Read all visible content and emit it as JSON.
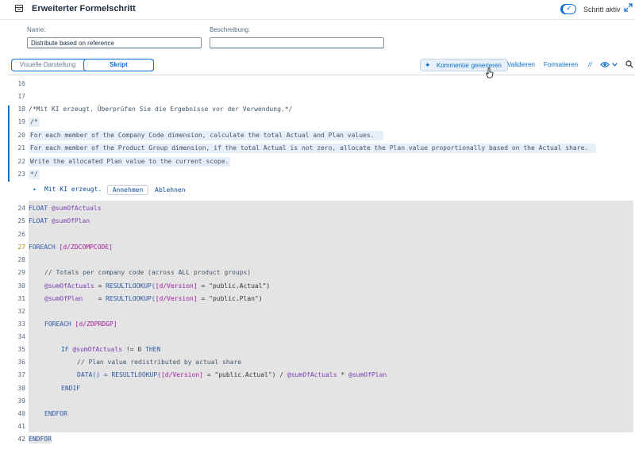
{
  "header": {
    "title": "Erweiterter Formelschritt",
    "step_active_label": "Schritt aktiv"
  },
  "form": {
    "name_label": "Name:",
    "name_value": "Distribute based on reference",
    "description_label": "Beschreibung:",
    "description_value": ""
  },
  "toolbar": {
    "tab_visual": "Visuelle Darstellung",
    "tab_script": "Skript",
    "generate_comment": "Kommentar generieren",
    "validate": "Validieren",
    "format": "Formatieren",
    "comment_toggle": "//"
  },
  "editor": {
    "line_numbers": [
      "16",
      "17",
      "18",
      "19",
      "20",
      "21",
      "22",
      "23",
      "24",
      "25",
      "26",
      "27",
      "28",
      "29",
      "30",
      "31",
      "32",
      "33",
      "34",
      "35",
      "36",
      "37",
      "38",
      "39",
      "40",
      "41",
      "42"
    ],
    "ai_comment_header": "/*Mit KI erzeugt. Überprüfen Sie die Ergebnisse vor der Verwendung.*/",
    "ai_comment_open": "/*",
    "ai_line_1": "For each member of the Company Code dimension, calculate the total Actual and Plan values.",
    "ai_line_2": "For each member of the Product Group dimension, if the total Actual is not zero, allocate the Plan value proportionally based on the Actual share.",
    "ai_line_3": "Write the allocated Plan value to the current scope.",
    "ai_comment_close": "*/",
    "ai_generated_label": "Mit KI erzeugt.",
    "accept_label": "Annehmen",
    "reject_label": "Ablehnen",
    "code": {
      "l24_kw": "FLOAT",
      "l24_var": "@sumOfActuals",
      "l25_kw": "FLOAT",
      "l25_var": "@sumOfPlan",
      "l27_kw": "FOREACH",
      "l27_dim": "[d/ZDCOMPCODE]",
      "l29_comment": "// Totals per company code (across ALL product groups)",
      "l30_var": "@sumOfActuals",
      "l30_eq": " = ",
      "l30_fn": "RESULTLOOKUP(",
      "l30_dim": "[d/Version]",
      "l30_rest": " = \"public.Actual\")",
      "l31_var": "@sumOfPlan",
      "l31_eq": "    = ",
      "l31_fn": "RESULTLOOKUP(",
      "l31_dim": "[d/Version]",
      "l31_rest": " = \"public.Plan\")",
      "l33_kw": "FOREACH",
      "l33_dim": "[d/ZDPRDGP]",
      "l35_kw": "IF",
      "l35_var": "@sumOfActuals",
      "l35_op": " != 0 ",
      "l35_kw2": "THEN",
      "l36_comment": "// Plan value redistributed by actual share",
      "l37_fn": "DATA() = RESULTLOOKUP(",
      "l37_dim": "[d/Version]",
      "l37_mid": " = \"public.Actual\") / ",
      "l37_var1": "@sumOfActuals",
      "l37_mul": " * ",
      "l37_var2": "@sumOfPlan",
      "l38_kw": "ENDIF",
      "l40_kw": "ENDFOR",
      "l42_kw": "ENDFOR"
    }
  },
  "colors": {
    "accent": "#0a6ed1",
    "selection": "#e4e4e4",
    "ai_highlight": "#e6eef7"
  }
}
